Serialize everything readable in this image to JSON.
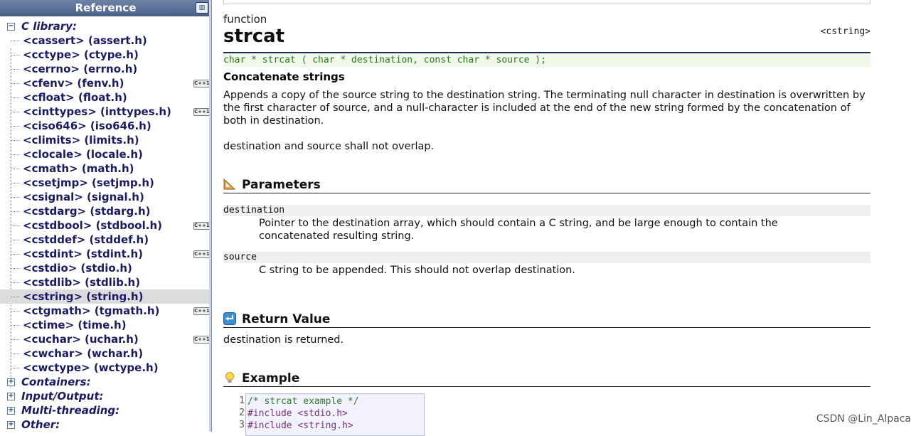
{
  "sidebar": {
    "header": "Reference",
    "library_group": "C library:",
    "items": [
      {
        "label": "<cassert> (assert.h)",
        "cpp": false
      },
      {
        "label": "<cctype> (ctype.h)",
        "cpp": false
      },
      {
        "label": "<cerrno> (errno.h)",
        "cpp": false
      },
      {
        "label": "<cfenv> (fenv.h)",
        "cpp": true
      },
      {
        "label": "<cfloat> (float.h)",
        "cpp": false
      },
      {
        "label": "<cinttypes> (inttypes.h)",
        "cpp": true
      },
      {
        "label": "<ciso646> (iso646.h)",
        "cpp": false
      },
      {
        "label": "<climits> (limits.h)",
        "cpp": false
      },
      {
        "label": "<clocale> (locale.h)",
        "cpp": false
      },
      {
        "label": "<cmath> (math.h)",
        "cpp": false
      },
      {
        "label": "<csetjmp> (setjmp.h)",
        "cpp": false
      },
      {
        "label": "<csignal> (signal.h)",
        "cpp": false
      },
      {
        "label": "<cstdarg> (stdarg.h)",
        "cpp": false
      },
      {
        "label": "<cstdbool> (stdbool.h)",
        "cpp": true
      },
      {
        "label": "<cstddef> (stddef.h)",
        "cpp": false
      },
      {
        "label": "<cstdint> (stdint.h)",
        "cpp": true
      },
      {
        "label": "<cstdio> (stdio.h)",
        "cpp": false
      },
      {
        "label": "<cstdlib> (stdlib.h)",
        "cpp": false
      },
      {
        "label": "<cstring> (string.h)",
        "cpp": false,
        "selected": true
      },
      {
        "label": "<ctgmath> (tgmath.h)",
        "cpp": true
      },
      {
        "label": "<ctime> (time.h)",
        "cpp": false
      },
      {
        "label": "<cuchar> (uchar.h)",
        "cpp": true
      },
      {
        "label": "<cwchar> (wchar.h)",
        "cpp": false
      },
      {
        "label": "<cwctype> (wctype.h)",
        "cpp": false
      }
    ],
    "collapsed_groups": [
      "Containers:",
      "Input/Output:",
      "Multi-threading:",
      "Other:"
    ],
    "cpp_badge": "C++11",
    "expand_symbol": "+",
    "collapse_symbol": "−"
  },
  "main": {
    "kind": "function",
    "title": "strcat",
    "header_ref": "<cstring>",
    "prototype": "char * strcat ( char * destination, const char * source );",
    "summary": "Concatenate strings",
    "description_1": "Appends a copy of the source string to the destination string. The terminating null character in destination is overwritten by the first character of source, and a null-character is included at the end of the new string formed by the concatenation of both in destination.",
    "description_2": "destination and source shall not overlap.",
    "parameters_title": "Parameters",
    "params": [
      {
        "name": "destination",
        "desc": "Pointer to the destination array, which should contain a C string, and be large enough to contain the concatenated resulting string."
      },
      {
        "name": "source",
        "desc": "C string to be appended. This should not overlap destination."
      }
    ],
    "return_title": "Return Value",
    "return_text": "destination is returned.",
    "example_title": "Example",
    "code_lines": [
      {
        "n": "1",
        "text": "/* strcat example */"
      },
      {
        "n": "2",
        "text": "#include <stdio.h>"
      },
      {
        "n": "3",
        "text": "#include <string.h>"
      }
    ]
  },
  "watermark": "CSDN @Lin_Alpaca",
  "colors": {
    "sidebar_header": "#5a6f96",
    "link": "#1a1a66",
    "prototype": "#257a25",
    "rule": "#1b2e55"
  }
}
